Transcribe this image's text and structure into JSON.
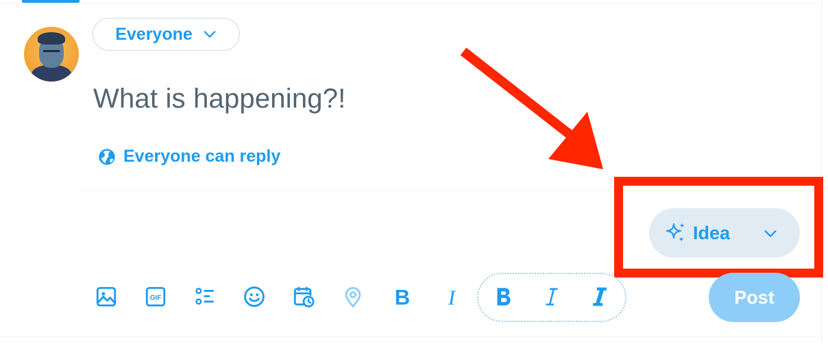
{
  "composer": {
    "audience_label": "Everyone",
    "placeholder": "What is happening?!",
    "reply_setting_label": "Everyone can reply"
  },
  "idea_button": {
    "label": "Idea",
    "icon": "sparkle-icon"
  },
  "toolbar": {
    "tools": [
      {
        "name": "media",
        "icon": "image-icon"
      },
      {
        "name": "gif",
        "icon": "gif-icon",
        "label": "GIF"
      },
      {
        "name": "poll",
        "icon": "poll-icon"
      },
      {
        "name": "emoji",
        "icon": "emoji-icon"
      },
      {
        "name": "schedule",
        "icon": "schedule-icon"
      },
      {
        "name": "location",
        "icon": "location-icon"
      },
      {
        "name": "bold",
        "icon": "bold-icon",
        "label": "B"
      },
      {
        "name": "italic",
        "icon": "italic-icon",
        "label": "I"
      }
    ],
    "format_group": [
      {
        "name": "bold-alt",
        "icon": "bold-alt-icon"
      },
      {
        "name": "italic-alt",
        "icon": "italic-alt-icon"
      },
      {
        "name": "bold-italic",
        "icon": "bold-italic-icon"
      }
    ]
  },
  "post_button": {
    "label": "Post",
    "state": "disabled"
  },
  "annotation": {
    "color": "#ff2600"
  },
  "colors": {
    "accent": "#1d9bf0",
    "idea_bg": "#e1ebf4",
    "post_disabled": "#8ecdf8",
    "placeholder_text": "#536471"
  }
}
